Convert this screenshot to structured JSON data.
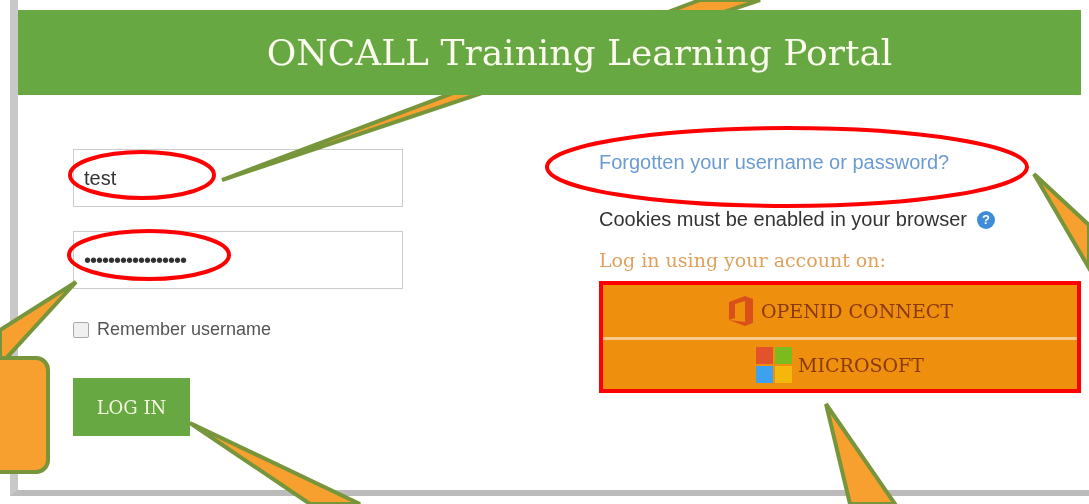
{
  "title": "ONCALL Training Learning Portal",
  "username": {
    "value": "test"
  },
  "password": {
    "value": "•••••••••••••••••"
  },
  "remember": {
    "label": "Remember username",
    "checked": false
  },
  "login_button": "LOG IN",
  "forgot_link": "Forgotten your username or password?",
  "cookies_notice": "Cookies must be enabled in your browser",
  "help_icon": "?",
  "oauth_heading": "Log in using your account on:",
  "providers": [
    {
      "kind": "openid",
      "label": "OPENID CONNECT"
    },
    {
      "kind": "microsoft",
      "label": "MICROSOFT"
    }
  ]
}
